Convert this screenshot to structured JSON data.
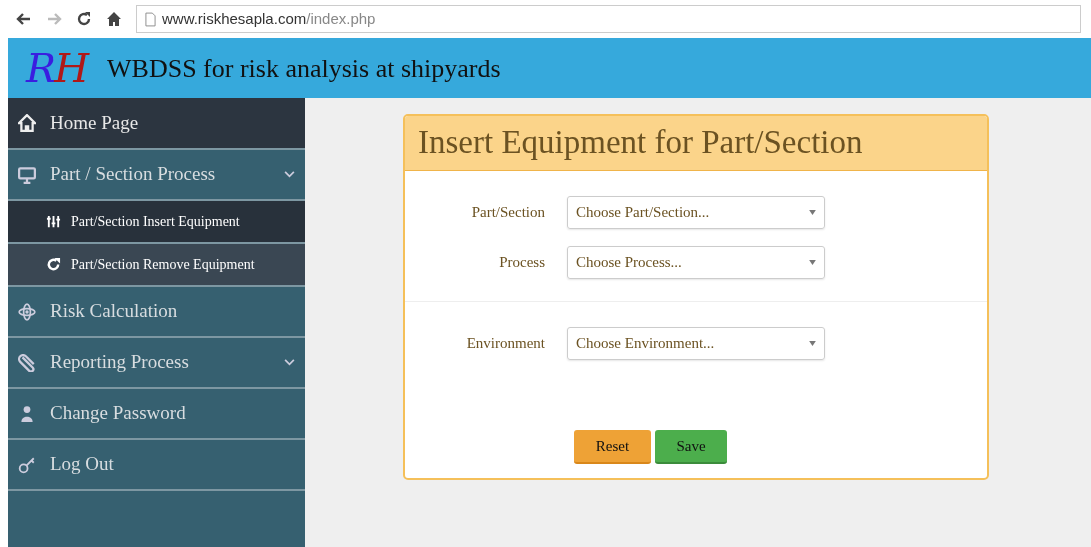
{
  "browser": {
    "url_host": "www.riskhesapla.com",
    "url_path": "/index.php"
  },
  "header": {
    "logo": "RH",
    "title": "WBDSS for risk analysis at shipyards"
  },
  "sidebar": {
    "items": [
      {
        "label": "Home Page",
        "kind": "link",
        "selected": true
      },
      {
        "label": "Part / Section Process",
        "kind": "submenu",
        "selected": false,
        "expanded": true,
        "children": [
          {
            "label": "Part/Section Insert Equipment",
            "selected": true
          },
          {
            "label": "Part/Section Remove Equipment",
            "selected": false
          }
        ]
      },
      {
        "label": "Risk Calculation",
        "kind": "link",
        "selected": false
      },
      {
        "label": "Reporting Process",
        "kind": "submenu",
        "selected": false
      },
      {
        "label": "Change Password",
        "kind": "link",
        "selected": false
      },
      {
        "label": "Log Out",
        "kind": "link",
        "selected": false
      }
    ]
  },
  "form": {
    "title": "Insert Equipment for Part/Section",
    "sections": [
      [
        {
          "label": "Part/Section",
          "placeholder": "Choose Part/Section..."
        },
        {
          "label": "Process",
          "placeholder": "Choose Process..."
        }
      ],
      [
        {
          "label": "Environment",
          "placeholder": "Choose Environment..."
        }
      ]
    ],
    "buttons": [
      {
        "label": "Reset",
        "kind": "reset"
      },
      {
        "label": "Save",
        "kind": "save"
      }
    ]
  }
}
